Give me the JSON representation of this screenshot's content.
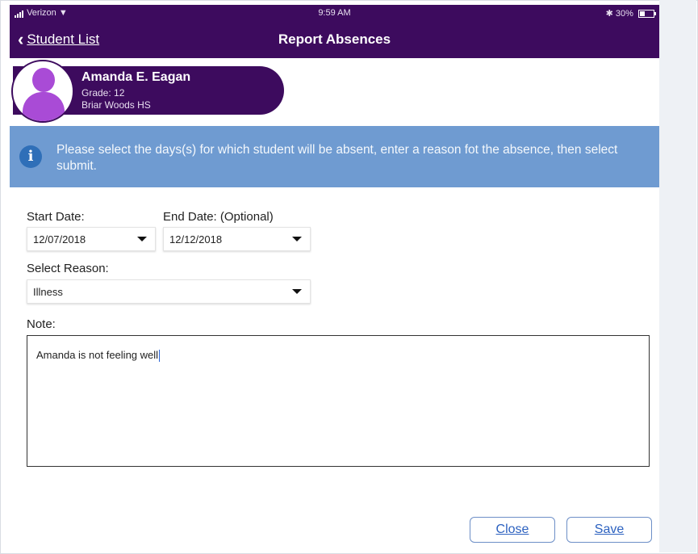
{
  "status_bar": {
    "carrier": "Verizon",
    "time": "9:59 AM",
    "battery": "30%"
  },
  "nav": {
    "back_label": "Student List",
    "title": "Report Absences"
  },
  "student": {
    "name": "Amanda E. Eagan",
    "grade": "Grade: 12",
    "school": "Briar Woods HS"
  },
  "info": {
    "icon": "info-icon",
    "message": "Please select the days(s) for which student will be absent, enter a reason fot the absence, then select submit."
  },
  "form": {
    "start_date_label": "Start Date:",
    "start_date_value": "12/07/2018",
    "end_date_label": "End Date: (Optional)",
    "end_date_value": "12/12/2018",
    "reason_label": "Select Reason:",
    "reason_value": "Illness",
    "note_label": "Note:",
    "note_value": "Amanda is not feeling well"
  },
  "buttons": {
    "close": "Close",
    "save": "Save"
  },
  "colors": {
    "brand": "#3d0b5e",
    "banner": "#6f9bd1",
    "avatar": "#a94bd6",
    "link": "#2d62c0"
  }
}
